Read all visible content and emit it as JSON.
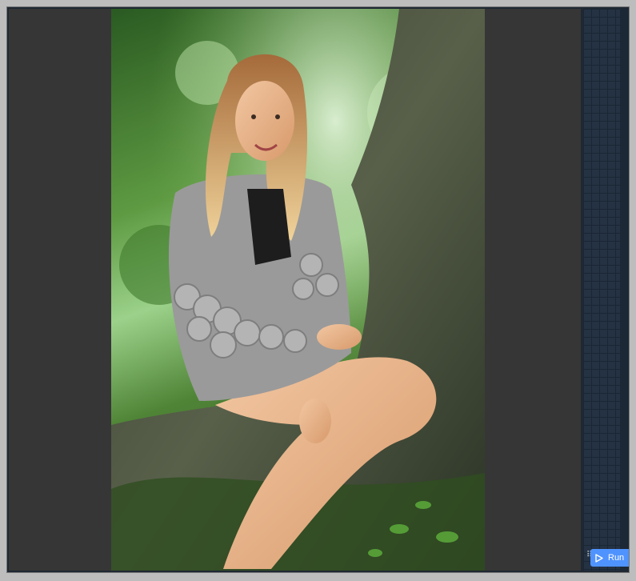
{
  "toolbar": {
    "run_label": "Run",
    "run_icon": "play-icon",
    "drag_icon": "drag-handle-icon"
  },
  "viewer": {
    "image_subject": "photo"
  },
  "colors": {
    "accent": "#4f93ff",
    "pane": "#363636",
    "grid_panel": "#243243",
    "outer": "#bdbdbd"
  }
}
